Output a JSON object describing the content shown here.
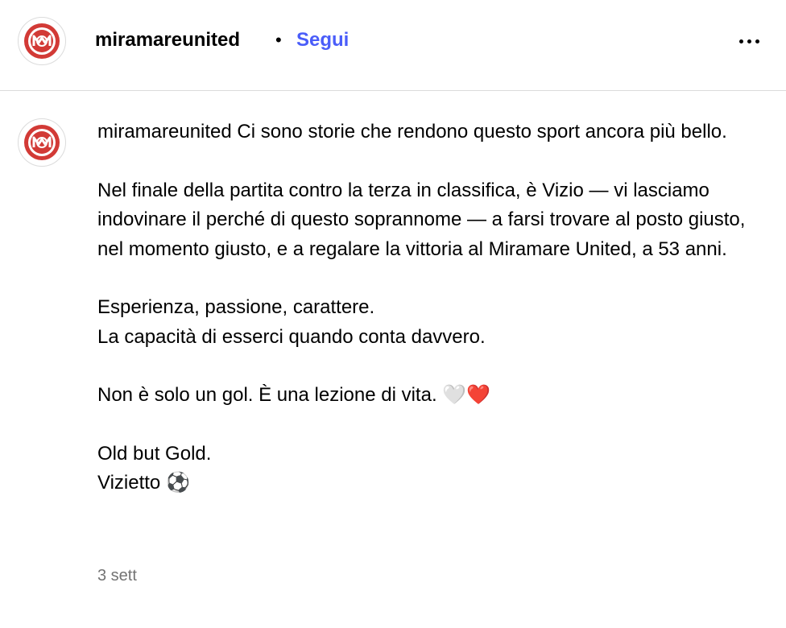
{
  "header": {
    "username": "miramareunited",
    "separator": "•",
    "follow_label": "Segui",
    "more_icon": "more-horizontal-icon"
  },
  "colors": {
    "follow_blue": "#4a5df9",
    "brand_red": "#d23a36",
    "timestamp_gray": "#737373",
    "divider": "#dbdbdb"
  },
  "post": {
    "username": "miramareunited",
    "lines": {
      "l1": "Ci sono storie che rendono questo sport ancora più bello.",
      "l2": "Nel finale della partita contro la terza in classifica, è Vizio — vi lasciamo indovinare il perché di questo soprannome — a farsi trovare al posto giusto, nel momento giusto, e a regalare la vittoria al Miramare United, a 53 anni.",
      "l3": "Esperienza, passione, carattere.",
      "l4": "La capacità di esserci quando conta davvero.",
      "l5": "Non è solo un gol. È una lezione di vita. 🤍❤️",
      "l6": "Old but Gold.",
      "l7": "Vizietto ⚽"
    },
    "timestamp": "3 sett"
  }
}
